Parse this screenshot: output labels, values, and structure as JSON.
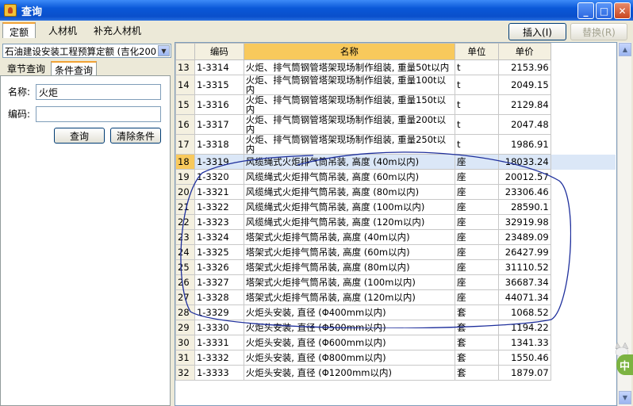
{
  "window": {
    "title": "查询"
  },
  "top_tabs": [
    {
      "label": "定额",
      "active": true
    },
    {
      "label": "人材机"
    },
    {
      "label": "补充人材机"
    }
  ],
  "toolbar": {
    "insert_label": "插入(I)",
    "replace_label": "替换(R)"
  },
  "left": {
    "quota_select": "石油建设安装工程预算定额 (吉化200",
    "subtabs": [
      "章节查询",
      "条件查询"
    ],
    "name_label": "名称:",
    "name_value": "火炬",
    "code_label": "编码:",
    "code_value": "",
    "query_label": "查询",
    "clear_label": "清除条件"
  },
  "grid": {
    "columns": [
      "",
      "编码",
      "名称",
      "单位",
      "单价"
    ],
    "rows": [
      {
        "n": "13",
        "code": "1-3314",
        "name": "火炬、排气筒钢管塔架现场制作组装, 重量50t以内",
        "unit": "t",
        "price": "2153.96"
      },
      {
        "n": "14",
        "code": "1-3315",
        "name": "火炬、排气筒钢管塔架现场制作组装, 重量100t以内",
        "unit": "t",
        "price": "2049.15"
      },
      {
        "n": "15",
        "code": "1-3316",
        "name": "火炬、排气筒钢管塔架现场制作组装, 重量150t以内",
        "unit": "t",
        "price": "2129.84"
      },
      {
        "n": "16",
        "code": "1-3317",
        "name": "火炬、排气筒钢管塔架现场制作组装, 重量200t以内",
        "unit": "t",
        "price": "2047.48"
      },
      {
        "n": "17",
        "code": "1-3318",
        "name": "火炬、排气筒钢管塔架现场制作组装, 重量250t以内",
        "unit": "t",
        "price": "1986.91"
      },
      {
        "n": "18",
        "code": "1-3319",
        "name": "风缆绳式火炬排气筒吊装, 高度 (40m以内)",
        "unit": "座",
        "price": "18033.24",
        "selected": true
      },
      {
        "n": "19",
        "code": "1-3320",
        "name": "风缆绳式火炬排气筒吊装, 高度 (60m以内)",
        "unit": "座",
        "price": "20012.57"
      },
      {
        "n": "20",
        "code": "1-3321",
        "name": "风缆绳式火炬排气筒吊装, 高度 (80m以内)",
        "unit": "座",
        "price": "23306.46"
      },
      {
        "n": "21",
        "code": "1-3322",
        "name": "风缆绳式火炬排气筒吊装, 高度 (100m以内)",
        "unit": "座",
        "price": "28590.1"
      },
      {
        "n": "22",
        "code": "1-3323",
        "name": "风缆绳式火炬排气筒吊装, 高度 (120m以内)",
        "unit": "座",
        "price": "32919.98"
      },
      {
        "n": "23",
        "code": "1-3324",
        "name": "塔架式火炬排气筒吊装, 高度 (40m以内)",
        "unit": "座",
        "price": "23489.09"
      },
      {
        "n": "24",
        "code": "1-3325",
        "name": "塔架式火炬排气筒吊装, 高度 (60m以内)",
        "unit": "座",
        "price": "26427.99"
      },
      {
        "n": "25",
        "code": "1-3326",
        "name": "塔架式火炬排气筒吊装, 高度 (80m以内)",
        "unit": "座",
        "price": "31110.52"
      },
      {
        "n": "26",
        "code": "1-3327",
        "name": "塔架式火炬排气筒吊装, 高度 (100m以内)",
        "unit": "座",
        "price": "36687.34"
      },
      {
        "n": "27",
        "code": "1-3328",
        "name": "塔架式火炬排气筒吊装, 高度 (120m以内)",
        "unit": "座",
        "price": "44071.34"
      },
      {
        "n": "28",
        "code": "1-3329",
        "name": "火炬头安装, 直径 (Φ400mm以内)",
        "unit": "套",
        "price": "1068.52"
      },
      {
        "n": "29",
        "code": "1-3330",
        "name": "火炬头安装, 直径 (Φ500mm以内)",
        "unit": "套",
        "price": "1194.22"
      },
      {
        "n": "30",
        "code": "1-3331",
        "name": "火炬头安装, 直径 (Φ600mm以内)",
        "unit": "套",
        "price": "1341.33"
      },
      {
        "n": "31",
        "code": "1-3332",
        "name": "火炬头安装, 直径 (Φ800mm以内)",
        "unit": "套",
        "price": "1550.46"
      },
      {
        "n": "32",
        "code": "1-3333",
        "name": "火炬头安装, 直径 (Φ1200mm以内)",
        "unit": "套",
        "price": "1879.07"
      }
    ]
  },
  "badge": {
    "text": "中"
  }
}
